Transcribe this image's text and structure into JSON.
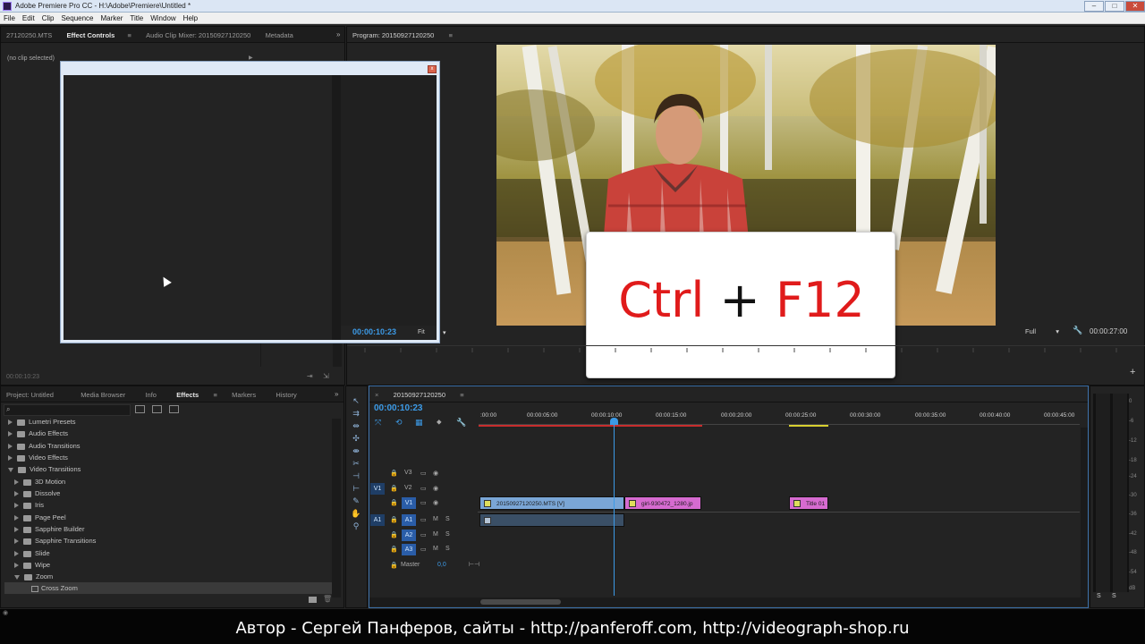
{
  "window": {
    "title": "Adobe Premiere Pro CC - H:\\Adobe\\Premiere\\Untitled *"
  },
  "menu": [
    "File",
    "Edit",
    "Clip",
    "Sequence",
    "Marker",
    "Title",
    "Window",
    "Help"
  ],
  "source_panel": {
    "tabs": [
      "27120250.MTS",
      "Effect Controls",
      "Audio Clip Mixer: 20150927120250",
      "Metadata"
    ],
    "no_clip": "(no clip selected)",
    "timecode": "00:00:10:23"
  },
  "program_monitor": {
    "tab": "Program: 20150927120250",
    "timecode": "00:00:10:23",
    "fit": "Fit",
    "quality": "Full",
    "duration": "00:00:27:00"
  },
  "shortcut_overlay": {
    "ctrl": "Ctrl",
    "plus": "+",
    "key": "F12"
  },
  "project_panel": {
    "tabs": [
      "Project: Untitled",
      "Media Browser",
      "Info",
      "Effects",
      "Markers",
      "History"
    ],
    "tree": [
      {
        "label": "Lumetri Presets",
        "level": 0,
        "open": false
      },
      {
        "label": "Audio Effects",
        "level": 0,
        "open": false
      },
      {
        "label": "Audio Transitions",
        "level": 0,
        "open": false
      },
      {
        "label": "Video Effects",
        "level": 0,
        "open": false
      },
      {
        "label": "Video Transitions",
        "level": 0,
        "open": true
      },
      {
        "label": "3D Motion",
        "level": 1,
        "open": false
      },
      {
        "label": "Dissolve",
        "level": 1,
        "open": false
      },
      {
        "label": "Iris",
        "level": 1,
        "open": false
      },
      {
        "label": "Page Peel",
        "level": 1,
        "open": false
      },
      {
        "label": "Sapphire Builder",
        "level": 1,
        "open": false
      },
      {
        "label": "Sapphire Transitions",
        "level": 1,
        "open": false
      },
      {
        "label": "Slide",
        "level": 1,
        "open": false
      },
      {
        "label": "Wipe",
        "level": 1,
        "open": false
      },
      {
        "label": "Zoom",
        "level": 1,
        "open": true
      },
      {
        "label": "Cross Zoom",
        "level": 2,
        "open": false
      }
    ]
  },
  "timeline": {
    "tab": "20150927120250",
    "timecode": "00:00:10:23",
    "ruler": [
      ":00:00",
      "00:00:05:00",
      "00:00:10:00",
      "00:00:15:00",
      "00:00:20:00",
      "00:00:25:00",
      "00:00:30:00",
      "00:00:35:00",
      "00:00:40:00",
      "00:00:45:00"
    ],
    "video_tracks": [
      "V3",
      "V2",
      "V1"
    ],
    "audio_tracks": [
      "A1",
      "A2",
      "A3"
    ],
    "source_v": "V1",
    "source_a": "A1",
    "master": "Master",
    "master_value": "0,0",
    "mute": "M",
    "solo": "S",
    "clips": {
      "v1_main": "20150927120250.MTS [V]",
      "v1_image": "girl-930472_1280.jp",
      "v1_title": "Title 01"
    }
  },
  "meter": {
    "scale": [
      "0",
      "-6",
      "-12",
      "-18",
      "-24",
      "-30",
      "-36",
      "-42",
      "-48",
      "-54",
      "dB"
    ],
    "solo": [
      "S",
      "S"
    ]
  },
  "caption": "Автор - Сергей Панферов, сайты - http://panferoff.com, http://videograph-shop.ru",
  "colors": {
    "accent": "#3c9ae6",
    "clip_video": "#7aa6d6",
    "clip_pink": "#d66bd0",
    "overlay_red": "#e01b1b"
  }
}
